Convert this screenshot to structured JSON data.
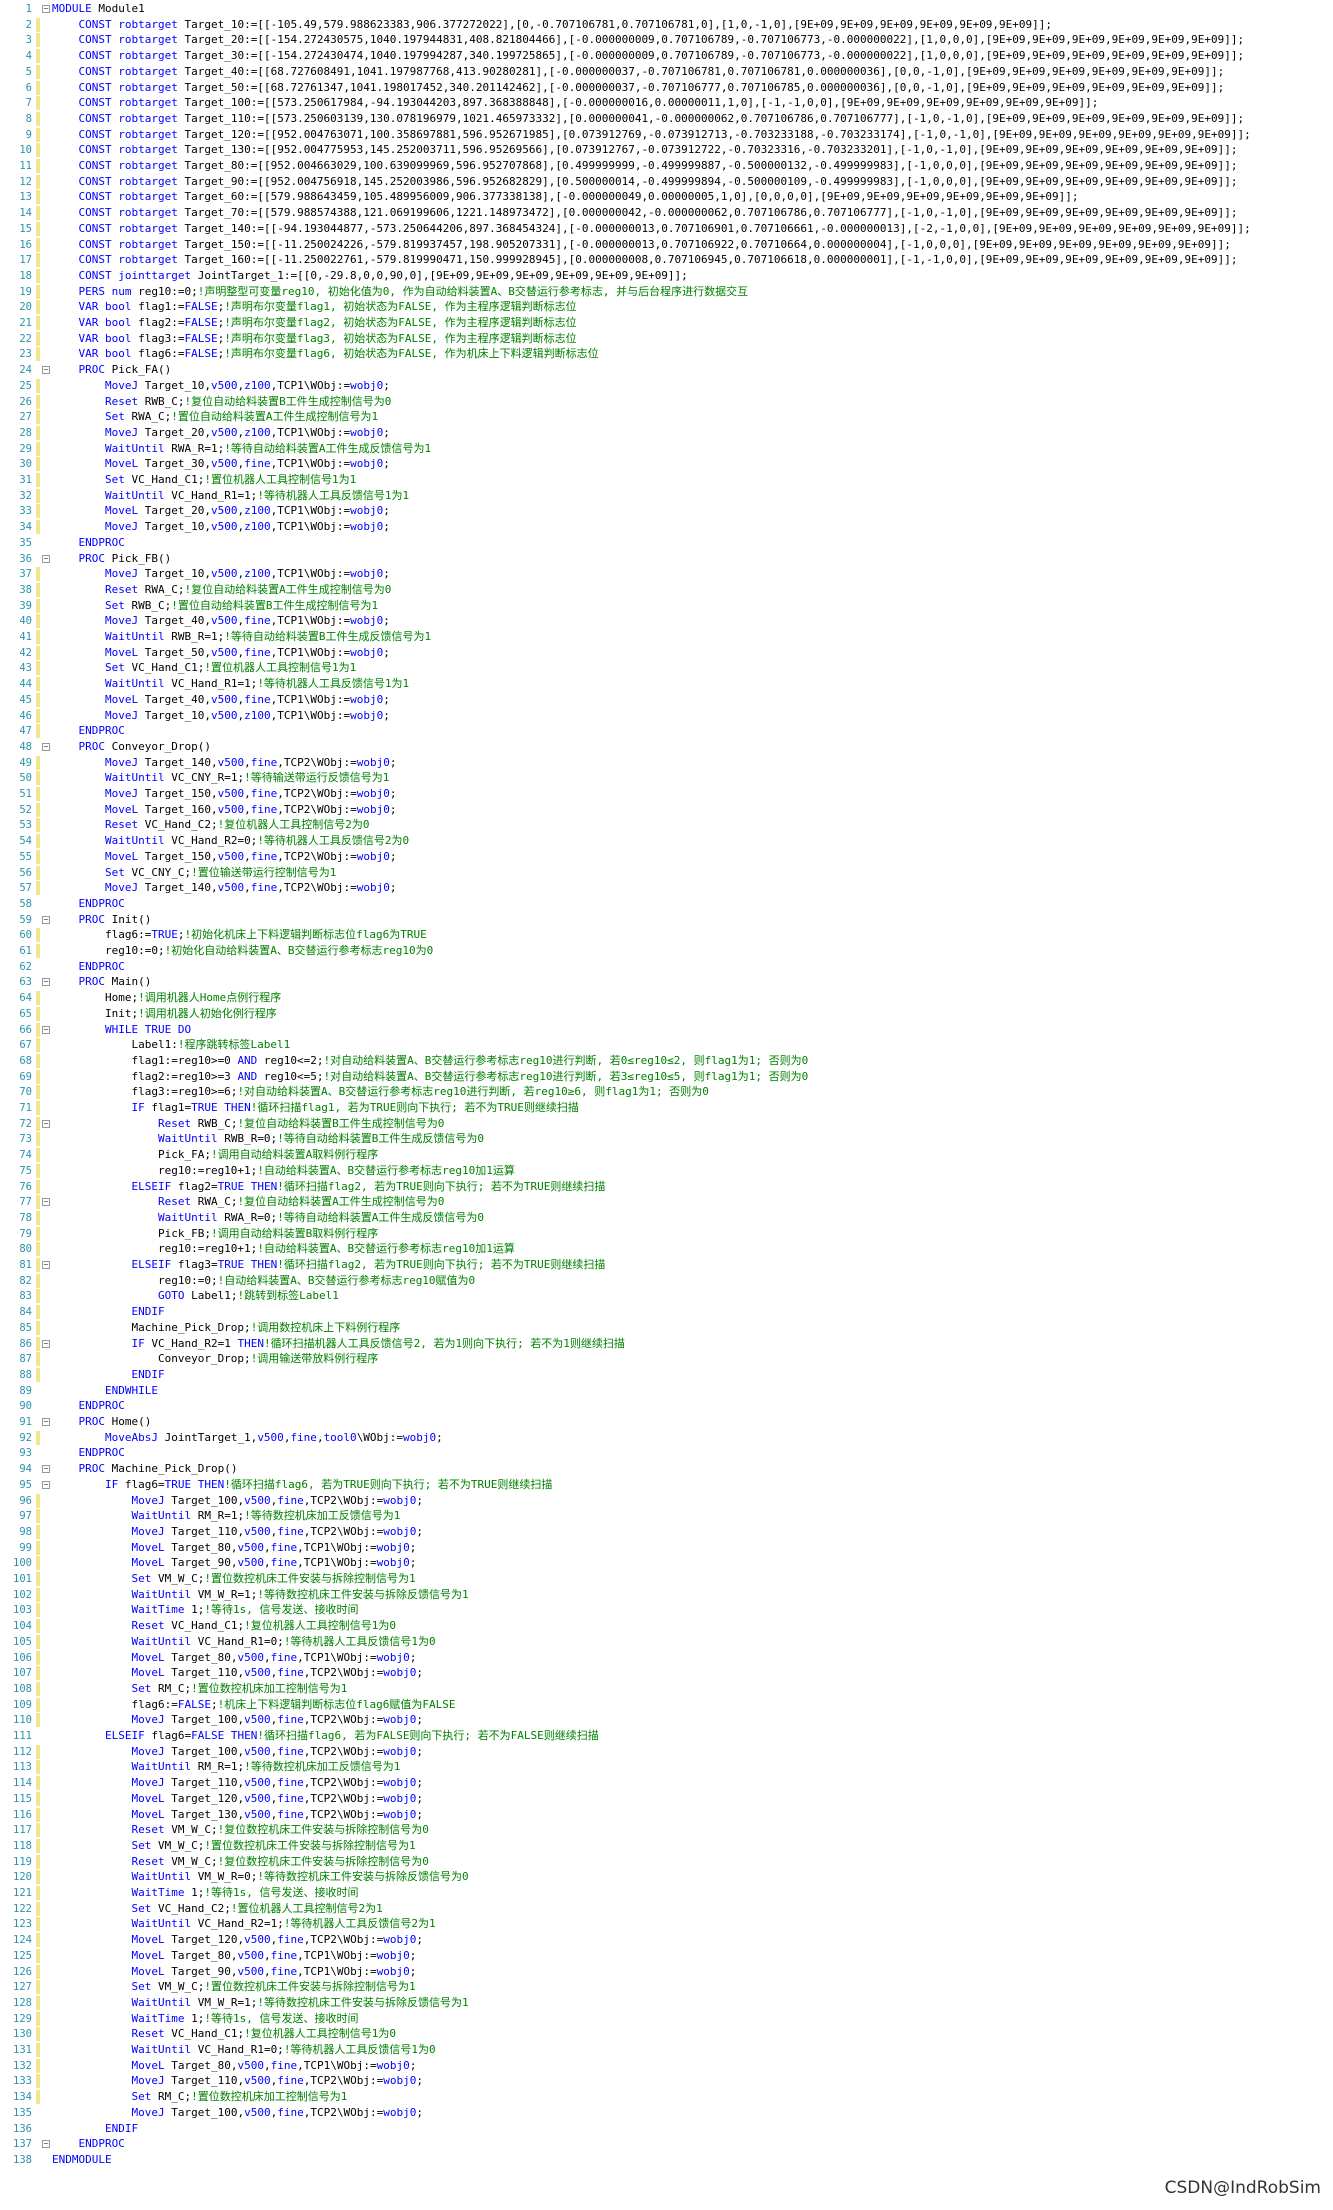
{
  "editor": {
    "markers": [
      2,
      3,
      4,
      5,
      6,
      7,
      8,
      9,
      10,
      11,
      12,
      13,
      14,
      15,
      16,
      17,
      18,
      19,
      20,
      21,
      22,
      23,
      25,
      26,
      27,
      28,
      29,
      30,
      31,
      32,
      33,
      34,
      37,
      38,
      39,
      40,
      41,
      42,
      43,
      44,
      45,
      46,
      47,
      49,
      50,
      51,
      52,
      53,
      54,
      55,
      56,
      57,
      60,
      61,
      64,
      65,
      66,
      67,
      68,
      69,
      70,
      71,
      72,
      73,
      74,
      75,
      76,
      77,
      78,
      79,
      80,
      81,
      82,
      83,
      84,
      85,
      86,
      87,
      88,
      92,
      96,
      97,
      98,
      99,
      100,
      101,
      102,
      103,
      104,
      105,
      106,
      107,
      108,
      109,
      110,
      112,
      113,
      114,
      115,
      116,
      117,
      118,
      119,
      120,
      121,
      122,
      123,
      124,
      125,
      126,
      127,
      128,
      129,
      130,
      131,
      132,
      133,
      134
    ],
    "folds": [
      1,
      24,
      36,
      48,
      59,
      63,
      66,
      72,
      77,
      81,
      86,
      91,
      94,
      95,
      137
    ],
    "lines": [
      "MODULE Module1",
      "    CONST robtarget Target_10:=[[-105.49,579.988623383,906.377272022],[0,-0.707106781,0.707106781,0],[1,0,-1,0],[9E+09,9E+09,9E+09,9E+09,9E+09,9E+09]];",
      "    CONST robtarget Target_20:=[[-154.272430575,1040.197944831,408.821804466],[-0.000000009,0.707106789,-0.707106773,-0.000000022],[1,0,0,0],[9E+09,9E+09,9E+09,9E+09,9E+09,9E+09]];",
      "    CONST robtarget Target_30:=[[-154.272430474,1040.197994287,340.199725865],[-0.000000009,0.707106789,-0.707106773,-0.000000022],[1,0,0,0],[9E+09,9E+09,9E+09,9E+09,9E+09,9E+09]];",
      "    CONST robtarget Target_40:=[[68.727608491,1041.197987768,413.90280281],[-0.000000037,-0.707106781,0.707106781,0.000000036],[0,0,-1,0],[9E+09,9E+09,9E+09,9E+09,9E+09,9E+09]];",
      "    CONST robtarget Target_50:=[[68.72761347,1041.198017452,340.201142462],[-0.000000037,-0.707106777,0.707106785,0.000000036],[0,0,-1,0],[9E+09,9E+09,9E+09,9E+09,9E+09,9E+09]];",
      "    CONST robtarget Target_100:=[[573.250617984,-94.193044203,897.368388848],[-0.000000016,0.00000011,1,0],[-1,-1,0,0],[9E+09,9E+09,9E+09,9E+09,9E+09,9E+09]];",
      "    CONST robtarget Target_110:=[[573.250603139,130.078196979,1021.465973332],[0.000000041,-0.000000062,0.707106786,0.707106777],[-1,0,-1,0],[9E+09,9E+09,9E+09,9E+09,9E+09,9E+09]];",
      "    CONST robtarget Target_120:=[[952.004763071,100.358697881,596.952671985],[0.073912769,-0.073912713,-0.703233188,-0.703233174],[-1,0,-1,0],[9E+09,9E+09,9E+09,9E+09,9E+09,9E+09]];",
      "    CONST robtarget Target_130:=[[952.004775953,145.252003711,596.95269566],[0.073912767,-0.073912722,-0.70323316,-0.703233201],[-1,0,-1,0],[9E+09,9E+09,9E+09,9E+09,9E+09,9E+09]];",
      "    CONST robtarget Target_80:=[[952.004663029,100.639099969,596.952707868],[0.499999999,-0.499999887,-0.500000132,-0.499999983],[-1,0,0,0],[9E+09,9E+09,9E+09,9E+09,9E+09,9E+09]];",
      "    CONST robtarget Target_90:=[[952.004756918,145.252003986,596.952682829],[0.500000014,-0.499999894,-0.500000109,-0.499999983],[-1,0,0,0],[9E+09,9E+09,9E+09,9E+09,9E+09,9E+09]];",
      "    CONST robtarget Target_60:=[[579.988643459,105.489956009,906.377338138],[-0.000000049,0.00000005,1,0],[0,0,0,0],[9E+09,9E+09,9E+09,9E+09,9E+09,9E+09]];",
      "    CONST robtarget Target_70:=[[579.988574388,121.069199606,1221.148973472],[0.000000042,-0.000000062,0.707106786,0.707106777],[-1,0,-1,0],[9E+09,9E+09,9E+09,9E+09,9E+09,9E+09]];",
      "    CONST robtarget Target_140:=[[-94.193044877,-573.250644206,897.368454324],[-0.000000013,0.707106901,0.707106661,-0.000000013],[-2,-1,0,0],[9E+09,9E+09,9E+09,9E+09,9E+09,9E+09]];",
      "    CONST robtarget Target_150:=[[-11.250024226,-579.819937457,198.905207331],[-0.000000013,0.707106922,0.70710664,0.000000004],[-1,0,0,0],[9E+09,9E+09,9E+09,9E+09,9E+09,9E+09]];",
      "    CONST robtarget Target_160:=[[-11.250022761,-579.819990471,150.999928945],[0.000000008,0.707106945,0.707106618,0.000000001],[-1,-1,0,0],[9E+09,9E+09,9E+09,9E+09,9E+09,9E+09]];",
      "    CONST jointtarget JointTarget_1:=[[0,-29.8,0,0,90,0],[9E+09,9E+09,9E+09,9E+09,9E+09,9E+09]];",
      "    PERS num reg10:=0;!声明整型可变量reg10, 初始化值为0, 作为自动给料装置A、B交替运行参考标志, 并与后台程序进行数据交互",
      "    VAR bool flag1:=FALSE;!声明布尔变量flag1, 初始状态为FALSE, 作为主程序逻辑判断标志位",
      "    VAR bool flag2:=FALSE;!声明布尔变量flag2, 初始状态为FALSE, 作为主程序逻辑判断标志位",
      "    VAR bool flag3:=FALSE;!声明布尔变量flag3, 初始状态为FALSE, 作为主程序逻辑判断标志位",
      "    VAR bool flag6:=FALSE;!声明布尔变量flag6, 初始状态为FALSE, 作为机床上下料逻辑判断标志位",
      "    PROC Pick_FA()",
      "        MoveJ Target_10,v500,z100,TCP1\\WObj:=wobj0;",
      "        Reset RWB_C;!复位自动给料装置B工件生成控制信号为0",
      "        Set RWA_C;!置位自动给料装置A工件生成控制信号为1",
      "        MoveJ Target_20,v500,z100,TCP1\\WObj:=wobj0;",
      "        WaitUntil RWA_R=1;!等待自动给料装置A工件生成反馈信号为1",
      "        MoveL Target_30,v500,fine,TCP1\\WObj:=wobj0;",
      "        Set VC_Hand_C1;!置位机器人工具控制信号1为1",
      "        WaitUntil VC_Hand_R1=1;!等待机器人工具反馈信号1为1",
      "        MoveL Target_20,v500,z100,TCP1\\WObj:=wobj0;",
      "        MoveJ Target_10,v500,z100,TCP1\\WObj:=wobj0;",
      "    ENDPROC",
      "    PROC Pick_FB()",
      "        MoveJ Target_10,v500,z100,TCP1\\WObj:=wobj0;",
      "        Reset RWA_C;!复位自动给料装置A工件生成控制信号为0",
      "        Set RWB_C;!置位自动给料装置B工件生成控制信号为1",
      "        MoveJ Target_40,v500,fine,TCP1\\WObj:=wobj0;",
      "        WaitUntil RWB_R=1;!等待自动给料装置B工件生成反馈信号为1",
      "        MoveL Target_50,v500,fine,TCP1\\WObj:=wobj0;",
      "        Set VC_Hand_C1;!置位机器人工具控制信号1为1",
      "        WaitUntil VC_Hand_R1=1;!等待机器人工具反馈信号1为1",
      "        MoveL Target_40,v500,fine,TCP1\\WObj:=wobj0;",
      "        MoveJ Target_10,v500,z100,TCP1\\WObj:=wobj0;",
      "    ENDPROC",
      "    PROC Conveyor_Drop()",
      "        MoveJ Target_140,v500,fine,TCP2\\WObj:=wobj0;",
      "        WaitUntil VC_CNY_R=1;!等待输送带运行反馈信号为1",
      "        MoveJ Target_150,v500,fine,TCP2\\WObj:=wobj0;",
      "        MoveL Target_160,v500,fine,TCP2\\WObj:=wobj0;",
      "        Reset VC_Hand_C2;!复位机器人工具控制信号2为0",
      "        WaitUntil VC_Hand_R2=0;!等待机器人工具反馈信号2为0",
      "        MoveL Target_150,v500,fine,TCP2\\WObj:=wobj0;",
      "        Set VC_CNY_C;!置位输送带运行控制信号为1",
      "        MoveJ Target_140,v500,fine,TCP2\\WObj:=wobj0;",
      "    ENDPROC",
      "    PROC Init()",
      "        flag6:=TRUE;!初始化机床上下料逻辑判断标志位flag6为TRUE",
      "        reg10:=0;!初始化自动给料装置A、B交替运行参考标志reg10为0",
      "    ENDPROC",
      "    PROC Main()",
      "        Home;!调用机器人Home点例行程序",
      "        Init;!调用机器人初始化例行程序",
      "        WHILE TRUE DO",
      "            Label1:!程序跳转标签Label1",
      "            flag1:=reg10>=0 AND reg10<=2;!对自动给料装置A、B交替运行参考标志reg10进行判断, 若0≤reg10≤2, 则flag1为1; 否则为0",
      "            flag2:=reg10>=3 AND reg10<=5;!对自动给料装置A、B交替运行参考标志reg10进行判断, 若3≤reg10≤5, 则flag1为1; 否则为0",
      "            flag3:=reg10>=6;!对自动给料装置A、B交替运行参考标志reg10进行判断, 若reg10≥6, 则flag1为1; 否则为0",
      "            IF flag1=TRUE THEN!循环扫描flag1, 若为TRUE则向下执行; 若不为TRUE则继续扫描",
      "                Reset RWB_C;!复位自动给料装置B工件生成控制信号为0",
      "                WaitUntil RWB_R=0;!等待自动给料装置B工件生成反馈信号为0",
      "                Pick_FA;!调用自动给料装置A取料例行程序",
      "                reg10:=reg10+1;!自动给料装置A、B交替运行参考标志reg10加1运算",
      "            ELSEIF flag2=TRUE THEN!循环扫描flag2, 若为TRUE则向下执行; 若不为TRUE则继续扫描",
      "                Reset RWA_C;!复位自动给料装置A工件生成控制信号为0",
      "                WaitUntil RWA_R=0;!等待自动给料装置A工件生成反馈信号为0",
      "                Pick_FB;!调用自动给料装置B取料例行程序",
      "                reg10:=reg10+1;!自动给料装置A、B交替运行参考标志reg10加1运算",
      "            ELSEIF flag3=TRUE THEN!循环扫描flag2, 若为TRUE则向下执行; 若不为TRUE则继续扫描",
      "                reg10:=0;!自动给料装置A、B交替运行参考标志reg10赋值为0",
      "                GOTO Label1;!跳转到标签Label1",
      "            ENDIF",
      "            Machine_Pick_Drop;!调用数控机床上下料例行程序",
      "            IF VC_Hand_R2=1 THEN!循环扫描机器人工具反馈信号2, 若为1则向下执行; 若不为1则继续扫描",
      "                Conveyor_Drop;!调用输送带放料例行程序",
      "            ENDIF",
      "        ENDWHILE",
      "    ENDPROC",
      "    PROC Home()",
      "        MoveAbsJ JointTarget_1,v500,fine,tool0\\WObj:=wobj0;",
      "    ENDPROC",
      "    PROC Machine_Pick_Drop()",
      "        IF flag6=TRUE THEN!循环扫描flag6, 若为TRUE则向下执行; 若不为TRUE则继续扫描",
      "            MoveJ Target_100,v500,fine,TCP2\\WObj:=wobj0;",
      "            WaitUntil RM_R=1;!等待数控机床加工反馈信号为1",
      "            MoveJ Target_110,v500,fine,TCP2\\WObj:=wobj0;",
      "            MoveL Target_80,v500,fine,TCP1\\WObj:=wobj0;",
      "            MoveL Target_90,v500,fine,TCP1\\WObj:=wobj0;",
      "            Set VM_W_C;!置位数控机床工件安装与拆除控制信号为1",
      "            WaitUntil VM_W_R=1;!等待数控机床工件安装与拆除反馈信号为1",
      "            WaitTime 1;!等待1s, 信号发送、接收时间",
      "            Reset VC_Hand_C1;!复位机器人工具控制信号1为0",
      "            WaitUntil VC_Hand_R1=0;!等待机器人工具反馈信号1为0",
      "            MoveL Target_80,v500,fine,TCP1\\WObj:=wobj0;",
      "            MoveL Target_110,v500,fine,TCP2\\WObj:=wobj0;",
      "            Set RM_C;!置位数控机床加工控制信号为1",
      "            flag6:=FALSE;!机床上下料逻辑判断标志位flag6赋值为FALSE",
      "            MoveJ Target_100,v500,fine,TCP2\\WObj:=wobj0;",
      "        ELSEIF flag6=FALSE THEN!循环扫描flag6, 若为FALSE则向下执行; 若不为FALSE则继续扫描",
      "            MoveJ Target_100,v500,fine,TCP2\\WObj:=wobj0;",
      "            WaitUntil RM_R=1;!等待数控机床加工反馈信号为1",
      "            MoveJ Target_110,v500,fine,TCP2\\WObj:=wobj0;",
      "            MoveL Target_120,v500,fine,TCP2\\WObj:=wobj0;",
      "            MoveL Target_130,v500,fine,TCP2\\WObj:=wobj0;",
      "            Reset VM_W_C;!复位数控机床工件安装与拆除控制信号为0",
      "            Set VM_W_C;!置位数控机床工件安装与拆除控制信号为1",
      "            Reset VM_W_C;!复位数控机床工件安装与拆除控制信号为0",
      "            WaitUntil VM_W_R=0;!等待数控机床工件安装与拆除反馈信号为0",
      "            WaitTime 1;!等待1s, 信号发送、接收时间",
      "            Set VC_Hand_C2;!置位机器人工具控制信号2为1",
      "            WaitUntil VC_Hand_R2=1;!等待机器人工具反馈信号2为1",
      "            MoveL Target_120,v500,fine,TCP2\\WObj:=wobj0;",
      "            MoveL Target_80,v500,fine,TCP1\\WObj:=wobj0;",
      "            MoveL Target_90,v500,fine,TCP1\\WObj:=wobj0;",
      "            Set VM_W_C;!置位数控机床工件安装与拆除控制信号为1",
      "            WaitUntil VM_W_R=1;!等待数控机床工件安装与拆除反馈信号为1",
      "            WaitTime 1;!等待1s, 信号发送、接收时间",
      "            Reset VC_Hand_C1;!复位机器人工具控制信号1为0",
      "            WaitUntil VC_Hand_R1=0;!等待机器人工具反馈信号1为0",
      "            MoveL Target_80,v500,fine,TCP1\\WObj:=wobj0;",
      "            MoveJ Target_110,v500,fine,TCP2\\WObj:=wobj0;",
      "            Set RM_C;!置位数控机床加工控制信号为1",
      "            MoveJ Target_100,v500,fine,TCP2\\WObj:=wobj0;",
      "        ENDIF",
      "    ENDPROC",
      "ENDMODULE"
    ]
  },
  "watermark": "CSDN@IndRobSim",
  "colors": {
    "keyword": "#0000ff",
    "comment": "#008000",
    "text": "#000000",
    "line_number": "#2b91af",
    "change_marker": "#f0e68c"
  }
}
